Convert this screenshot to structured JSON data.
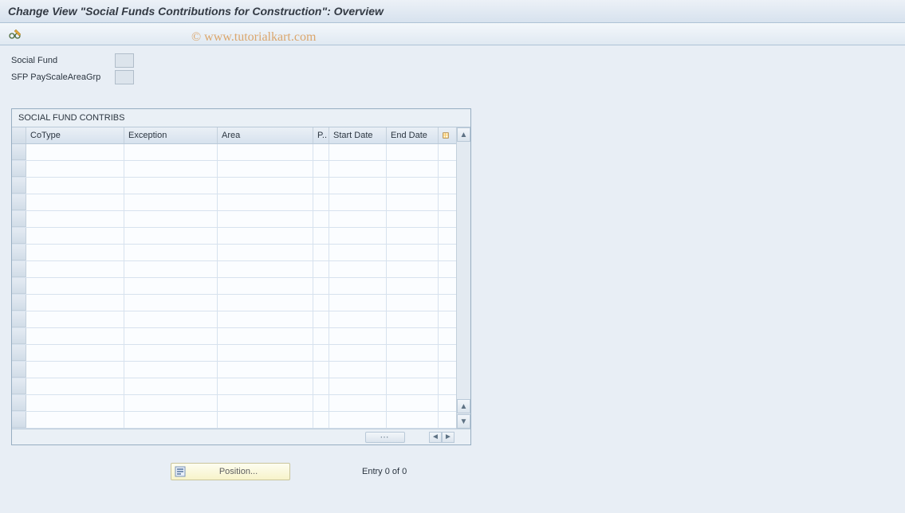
{
  "title": "Change View \"Social Funds Contributions for Construction\": Overview",
  "watermark": "© www.tutorialkart.com",
  "fields": {
    "social_fund_label": "Social Fund",
    "sfp_payscale_label": "SFP PayScaleAreaGrp"
  },
  "table": {
    "title": "SOCIAL FUND CONTRIBS",
    "columns": {
      "cotype": "CoType",
      "exception": "Exception",
      "area": "Area",
      "p": "P..",
      "start": "Start Date",
      "end": "End Date"
    },
    "row_count": 17
  },
  "footer": {
    "position_label": "Position...",
    "entry_text": "Entry 0 of 0"
  }
}
